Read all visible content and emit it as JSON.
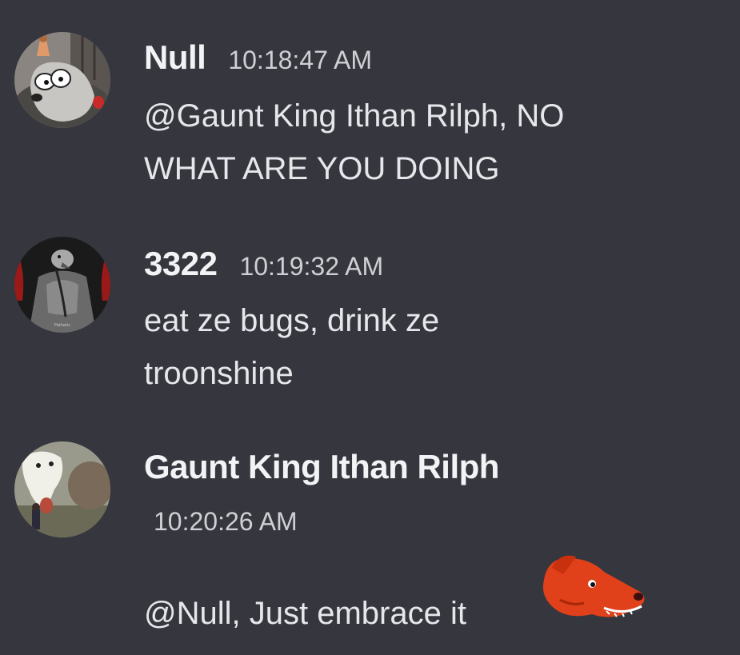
{
  "messages": [
    {
      "username": "Null",
      "timestamp": "10:18:47 AM",
      "text": "@Gaunt King Ithan Rilph, NO WHAT ARE YOU DOING",
      "avatar_icon": "cartoon-dog-avatar"
    },
    {
      "username": "3322",
      "timestamp": "10:19:32 AM",
      "text": "eat ze bugs, drink ze troonshine",
      "avatar_icon": "hooded-pigeon-avatar",
      "avatar_caption": "Pathetic"
    },
    {
      "username": "Gaunt King Ithan Rilph",
      "timestamp": "10:20:26 AM",
      "text": "@Null, Just embrace it",
      "avatar_icon": "white-dog-avatar",
      "emoji_icon": "red-dog-head-emoji"
    }
  ],
  "colors": {
    "background": "#36373e",
    "username": "#f2f3f5",
    "message_text": "#e6e7ea",
    "timestamp": "#cfd0d4"
  }
}
